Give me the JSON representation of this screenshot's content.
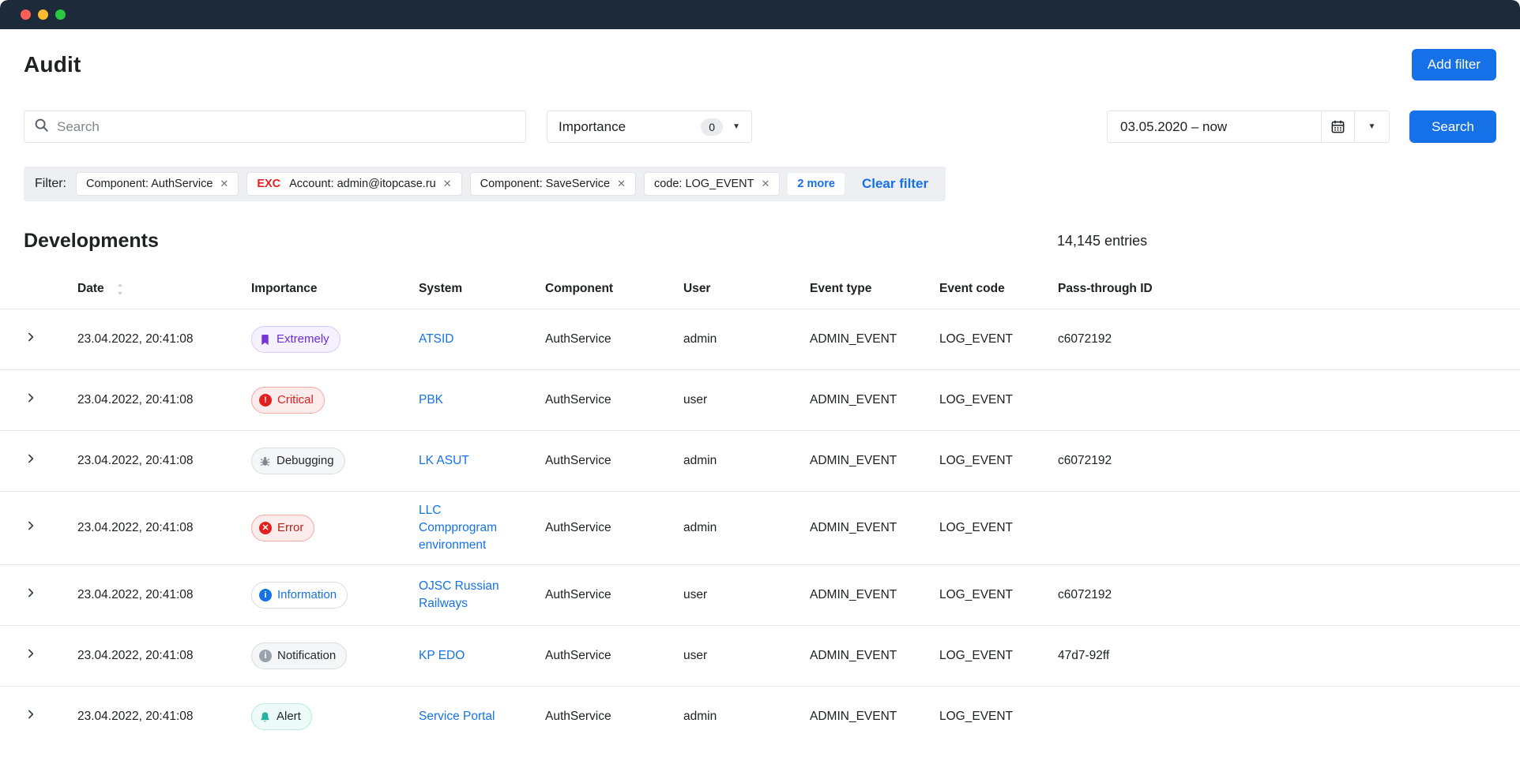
{
  "window": {
    "traffic_lights": [
      "close",
      "minimize",
      "zoom"
    ]
  },
  "header": {
    "title": "Audit",
    "add_filter_label": "Add filter"
  },
  "toolbar": {
    "search_placeholder": "Search",
    "importance_label": "Importance",
    "importance_count": "0",
    "date_range": "03.05.2020 – now",
    "search_button_label": "Search"
  },
  "filter_bar": {
    "label": "Filter:",
    "chips": [
      {
        "prefix": "",
        "text": "Component: AuthService"
      },
      {
        "prefix": "EXC",
        "text": "Account: admin@itopcase.ru"
      },
      {
        "prefix": "",
        "text": "Component: SaveService"
      },
      {
        "prefix": "",
        "text": "code: LOG_EVENT"
      }
    ],
    "more_label": "2 more",
    "clear_label": "Clear filter"
  },
  "section": {
    "title": "Developments",
    "entries_count": "14,145 entries"
  },
  "table": {
    "columns": [
      "Date",
      "Importance",
      "System",
      "Component",
      "User",
      "Event type",
      "Event code",
      "Pass-through ID"
    ],
    "rows": [
      {
        "date": "23.04.2022, 20:41:08",
        "importance": "Extremely",
        "badge": "extremely",
        "icon": "bookmark-icon",
        "system": "ATSID",
        "component": "AuthService",
        "user": "admin",
        "event_type": "ADMIN_EVENT",
        "event_code": "LOG_EVENT",
        "pass_id": "c6072192"
      },
      {
        "date": "23.04.2022, 20:41:08",
        "importance": "Critical",
        "badge": "critical",
        "icon": "exclamation-circle-icon",
        "system": "PBK",
        "component": "AuthService",
        "user": "user",
        "event_type": "ADMIN_EVENT",
        "event_code": "LOG_EVENT",
        "pass_id": ""
      },
      {
        "date": "23.04.2022, 20:41:08",
        "importance": "Debugging",
        "badge": "debugging",
        "icon": "bug-icon",
        "system": "LK ASUT",
        "component": "AuthService",
        "user": "admin",
        "event_type": "ADMIN_EVENT",
        "event_code": "LOG_EVENT",
        "pass_id": "c6072192"
      },
      {
        "date": "23.04.2022, 20:41:08",
        "importance": "Error",
        "badge": "error",
        "icon": "x-circle-icon",
        "system": "LLC Compprogram environment",
        "component": "AuthService",
        "user": "admin",
        "event_type": "ADMIN_EVENT",
        "event_code": "LOG_EVENT",
        "pass_id": ""
      },
      {
        "date": "23.04.2022, 20:41:08",
        "importance": "Information",
        "badge": "information",
        "icon": "info-circle-icon",
        "system": "OJSC Russian Railways",
        "component": "AuthService",
        "user": "user",
        "event_type": "ADMIN_EVENT",
        "event_code": "LOG_EVENT",
        "pass_id": "c6072192"
      },
      {
        "date": "23.04.2022, 20:41:08",
        "importance": "Notification",
        "badge": "notification",
        "icon": "info-circle-icon",
        "system": "KP EDO",
        "component": "AuthService",
        "user": "user",
        "event_type": "ADMIN_EVENT",
        "event_code": "LOG_EVENT",
        "pass_id": "47d7-92ff"
      },
      {
        "date": "23.04.2022, 20:41:08",
        "importance": "Alert",
        "badge": "alert",
        "icon": "bell-icon",
        "system": "Service Portal",
        "component": "AuthService",
        "user": "admin",
        "event_type": "ADMIN_EVENT",
        "event_code": "LOG_EVENT",
        "pass_id": ""
      }
    ]
  },
  "colors": {
    "accent_blue": "#1670e8",
    "titlebar": "#1d2a3a",
    "exclude_red": "#e3201f",
    "badge_purple": "#6d2bd9",
    "badge_teal": "#23b3a2"
  }
}
